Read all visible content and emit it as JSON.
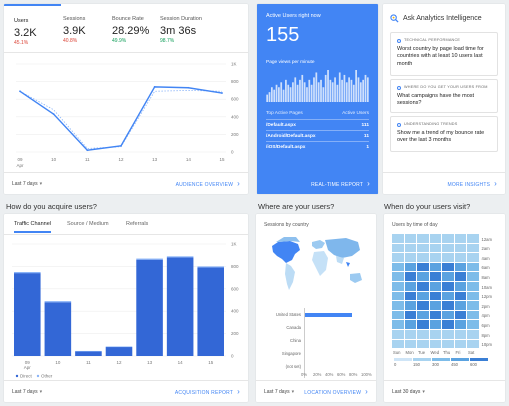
{
  "overview": {
    "metrics": [
      {
        "label": "Users",
        "value": "3.2K",
        "change": "45.1%",
        "dir": "down"
      },
      {
        "label": "Sessions",
        "value": "3.9K",
        "change": "40.8%",
        "dir": "down"
      },
      {
        "label": "Bounce Rate",
        "value": "28.29%",
        "change": "49.9%",
        "dir": "down"
      },
      {
        "label": "Session Duration",
        "value": "3m 36s",
        "change": "98.7%",
        "dir": "up"
      }
    ],
    "x_labels": [
      "09",
      "10",
      "11",
      "12",
      "13",
      "14",
      "15"
    ],
    "x_sub": "Apr",
    "y_labels": [
      "1K",
      "800",
      "600",
      "400",
      "200",
      "0"
    ],
    "current": [
      690,
      430,
      20,
      70,
      740,
      730,
      670
    ],
    "previous": [
      690,
      480,
      40,
      60,
      690,
      700,
      690
    ],
    "footer_range": "Last 7 days",
    "footer_link": "AUDIENCE OVERVIEW"
  },
  "realtime": {
    "title": "Active Users right now",
    "count": "155",
    "subtitle": "Page views per minute",
    "bars": [
      3,
      4,
      6,
      5,
      7,
      6,
      8,
      5,
      9,
      7,
      6,
      8,
      10,
      7,
      9,
      11,
      8,
      6,
      9,
      7,
      10,
      12,
      8,
      9,
      6,
      11,
      13,
      9,
      8,
      10,
      7,
      12,
      9,
      11,
      8,
      10,
      9,
      7,
      13,
      10,
      8,
      9,
      11,
      10
    ],
    "table_head": [
      "Top Active Pages",
      "Active Users"
    ],
    "rows": [
      [
        "/Default.aspx",
        "111"
      ],
      [
        "/Android/Default.aspx",
        "11"
      ],
      [
        "/iOS/Default.aspx",
        "1"
      ]
    ],
    "footer_link": "REAL-TIME REPORT"
  },
  "intelligence": {
    "title": "Ask Analytics Intelligence",
    "items": [
      {
        "tag": "TECHNICAL PERFORMANCE",
        "text": "Worst country by page load time for countries with at least 10 users last month"
      },
      {
        "tag": "WHERE DO YOU GET YOUR USERS FROM",
        "text": "What campaigns have the most sessions?"
      },
      {
        "tag": "UNDERSTANDING TRENDS",
        "text": "Show me a trend of my bounce rate over the last 3 months"
      }
    ],
    "footer_link": "MORE INSIGHTS"
  },
  "acquire": {
    "heading": "How do you acquire users?",
    "tabs": [
      "Traffic Channel",
      "Source / Medium",
      "Referrals"
    ],
    "x_labels": [
      "09",
      "10",
      "11",
      "12",
      "13",
      "14",
      "15"
    ],
    "x_sub": "Apr",
    "y_labels": [
      "1K",
      "800",
      "600",
      "400",
      "200",
      "0"
    ],
    "direct": [
      740,
      480,
      40,
      80,
      860,
      880,
      790
    ],
    "other": [
      10,
      10,
      5,
      5,
      10,
      10,
      10
    ],
    "legend": [
      "Direct",
      "Other"
    ],
    "footer_range": "Last 7 days",
    "footer_link": "ACQUISITION REPORT"
  },
  "where": {
    "heading": "Where are your users?",
    "subtitle": "Sessions by country",
    "countries": [
      [
        "United States",
        80
      ],
      [
        "Canada",
        0
      ],
      [
        "China",
        0
      ],
      [
        "Singapore",
        0
      ],
      [
        "(not set)",
        0
      ]
    ],
    "x_ticks": [
      "0%",
      "20%",
      "40%",
      "60%",
      "80%",
      "100%"
    ],
    "footer_range": "Last 7 days",
    "footer_link": "LOCATION OVERVIEW"
  },
  "when": {
    "heading": "When do your users visit?",
    "subtitle": "Users by time of day",
    "hours": [
      "12am",
      "2am",
      "4am",
      "6am",
      "8am",
      "10am",
      "12pm",
      "2pm",
      "4pm",
      "6pm",
      "8pm",
      "10pm"
    ],
    "days": [
      "Sun",
      "Mon",
      "Tue",
      "Wed",
      "Thu",
      "Fri",
      "Sat"
    ],
    "legend": [
      "0",
      "150",
      "300",
      "450",
      "600"
    ],
    "footer_range": "Last 30 days"
  },
  "colors": {
    "blue": "#4285f4",
    "bar": "#3367d6",
    "light": "#a8d3f0",
    "red": "#db4437",
    "green": "#0f9d58"
  }
}
